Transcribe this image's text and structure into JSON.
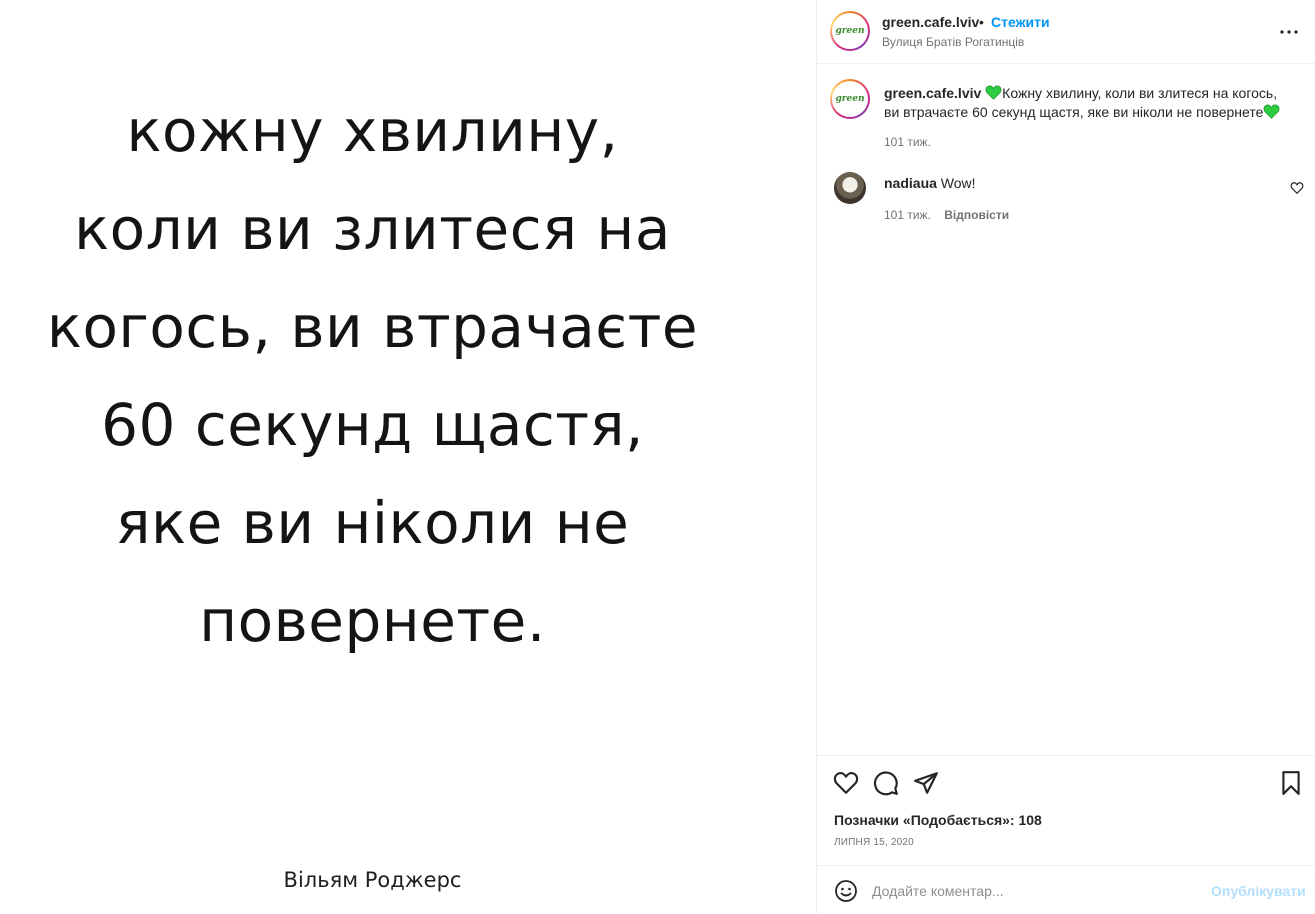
{
  "post": {
    "quote_lines": [
      "кожну хвилину,",
      "коли ви злитеся на",
      "когось, ви втрачаєте",
      "60 секунд щастя,",
      "яке ви ніколи не",
      "повернете."
    ],
    "author": "Вільям Роджерс"
  },
  "header": {
    "username": "green.cafe.lviv",
    "separator": "•",
    "follow_label": "Стежити",
    "location": "Вулиця Братів Рогатинців",
    "avatar_logo_text": "green",
    "more_icon": "more-horizontal-icon"
  },
  "caption": {
    "username": "green.cafe.lviv",
    "text": "Кожну хвилину, коли ви злитеся на когось, ви втрачаєте 60 секунд щастя, яке ви ніколи не повернете",
    "time": "101 тиж.",
    "heart_color": "#2ecc40"
  },
  "comments": [
    {
      "username": "nadiaua",
      "text": "Wow!",
      "time": "101 тиж.",
      "reply_label": "Відповісти"
    }
  ],
  "actions": {
    "icons": [
      "heart-icon",
      "comment-icon",
      "share-icon",
      "bookmark-icon"
    ],
    "likes_text": "Позначки «Подобається»: 108",
    "date": "ЛИПНЯ 15, 2020"
  },
  "comment_box": {
    "placeholder": "Додайте коментар...",
    "publish_label": "Опублікувати"
  },
  "colors": {
    "accent": "#0095f6",
    "publish_disabled": "#b2dffc",
    "muted": "#737373"
  }
}
